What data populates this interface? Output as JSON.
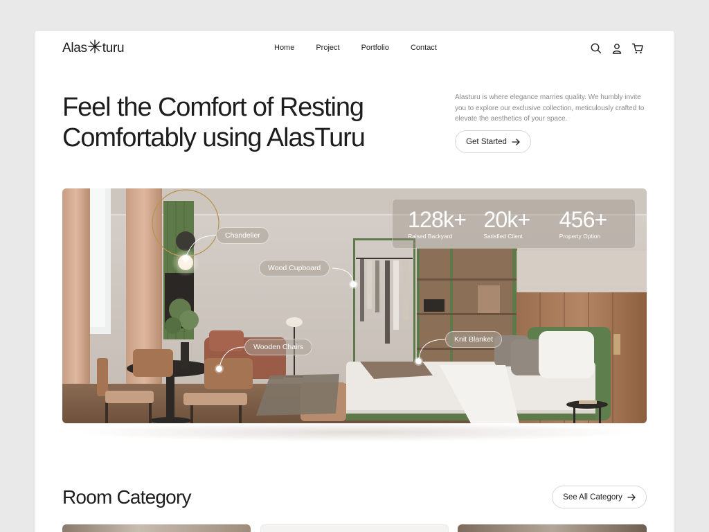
{
  "nav": {
    "logo_left": "Alas",
    "logo_right": "turu",
    "links": [
      "Home",
      "Project",
      "Portfolio",
      "Contact"
    ],
    "icons": [
      "search-icon",
      "user-icon",
      "cart-icon"
    ]
  },
  "hero": {
    "title_line1": "Feel the Comfort of Resting",
    "title_line2": "Comfortably using AlasTuru",
    "description": "Alasturu is where elegance marries quality. We humbly invite you to explore our exclusive collection, meticulously crafted to elevate the aesthetics of your space.",
    "cta_label": "Get Started"
  },
  "stats": [
    {
      "value": "128k+",
      "label": "Raised Backyard"
    },
    {
      "value": "20k+",
      "label": "Satisfied Client"
    },
    {
      "value": "456+",
      "label": "Property Option"
    }
  ],
  "tags": {
    "chandelier": "Chandelier",
    "cupboard": "Wood Cupboard",
    "chairs": "Wooden Chairs",
    "blanket": "Knit Blanket"
  },
  "category": {
    "title": "Room Category",
    "see_all_label": "See All Category"
  },
  "colors": {
    "accent_green": "#5e7a4a",
    "page_bg": "#e9e9e9",
    "text_dark": "#1d1d1d",
    "text_muted": "#8a8a8a"
  }
}
